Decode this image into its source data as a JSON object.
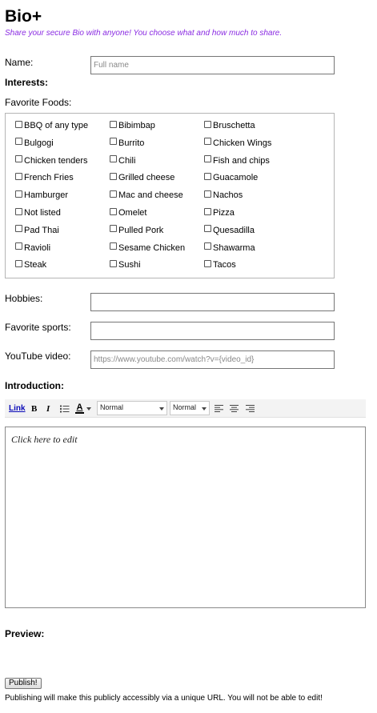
{
  "app": {
    "title": "Bio+",
    "tagline": "Share your secure Bio with anyone! You choose what and how much to share."
  },
  "name": {
    "label": "Name:",
    "placeholder": "Full name",
    "value": ""
  },
  "interests": {
    "heading": "Interests:"
  },
  "favorite_foods": {
    "label": "Favorite Foods:",
    "items": [
      "BBQ of any type",
      "Bibimbap",
      "Bruschetta",
      "Bulgogi",
      "Burrito",
      "Chicken Wings",
      "Chicken tenders",
      "Chili",
      "Fish and chips",
      "French Fries",
      "Grilled cheese",
      "Guacamole",
      "Hamburger",
      "Mac and cheese",
      "Nachos",
      "Not listed",
      "Omelet",
      "Pizza",
      "Pad Thai",
      "Pulled Pork",
      "Quesadilla",
      "Ravioli",
      "Sesame Chicken",
      "Shawarma",
      "Steak",
      "Sushi",
      "Tacos"
    ],
    "checked": []
  },
  "hobbies": {
    "label": "Hobbies:",
    "value": ""
  },
  "sports": {
    "label": "Favorite sports:",
    "value": ""
  },
  "youtube": {
    "label": "YouTube video:",
    "placeholder": "https://www.youtube.com/watch?v={video_id}",
    "value": ""
  },
  "introduction": {
    "heading": "Introduction:",
    "toolbar": {
      "link": "Link",
      "bold": "B",
      "italic": "I",
      "font_color_letter": "A",
      "font_color": "#000000",
      "format_select": "Normal",
      "size_select": "Normal"
    },
    "editor_placeholder": "Click here to edit"
  },
  "preview": {
    "heading": "Preview:"
  },
  "publish": {
    "button_label": "Publish!",
    "note": "Publishing will make this publicly accessibly via a unique URL. You will not be able to edit!"
  }
}
